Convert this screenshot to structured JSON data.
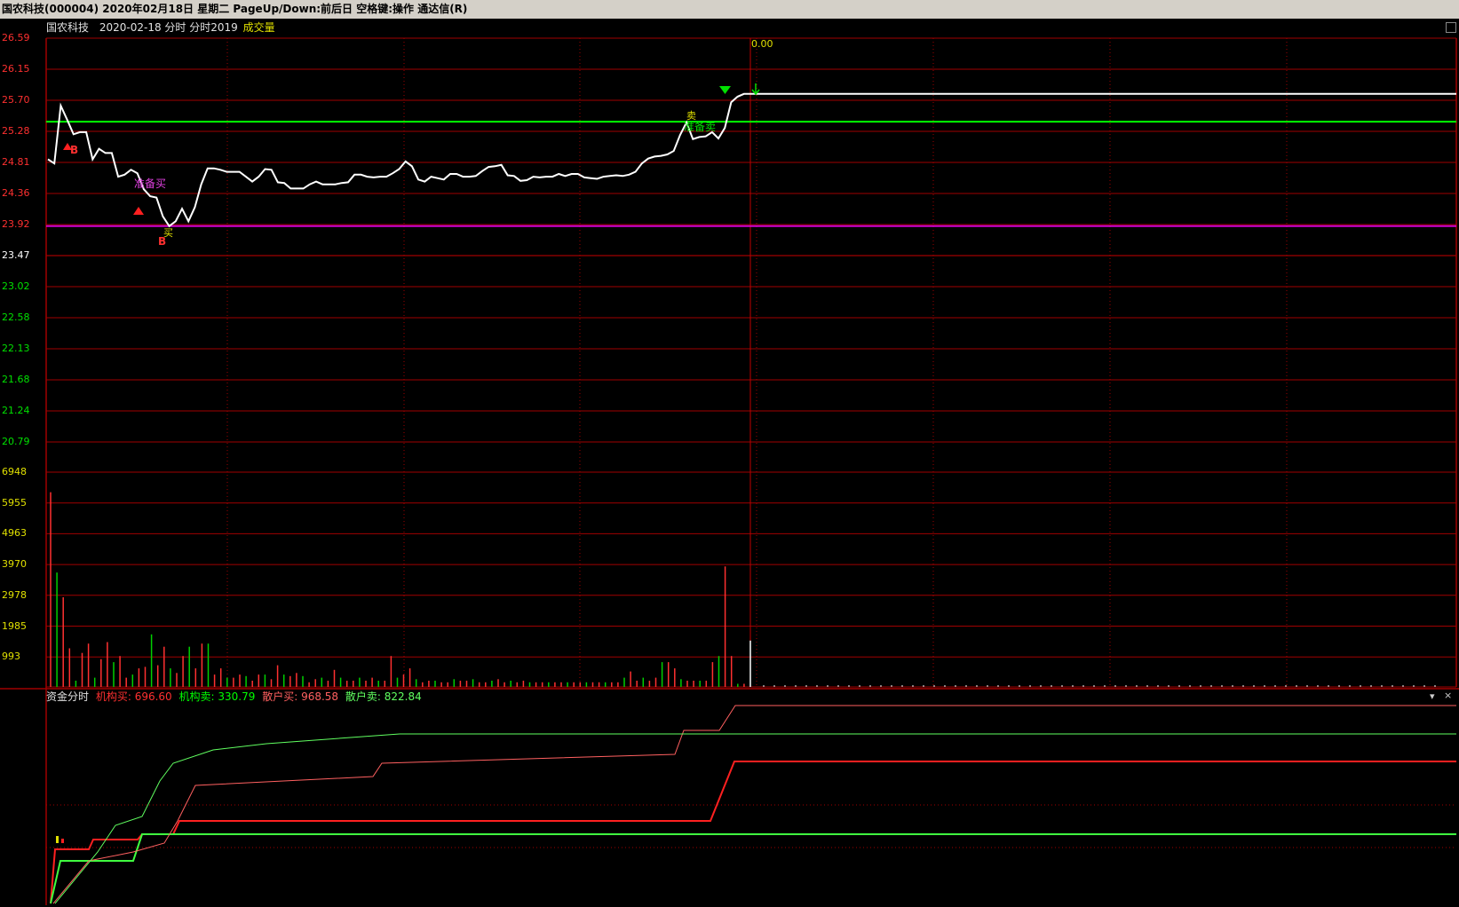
{
  "window": {
    "title": "国农科技(000004)  2020年02月18日  星期二  PageUp/Down:前后日  空格键:操作  通达信(R)"
  },
  "price_panel": {
    "stock_name": "国农科技",
    "date_mode": "2020-02-18  分时  分时2019",
    "volume_label": "成交量",
    "cursor_value": "0.00",
    "price_labels": [
      {
        "text": "26.59",
        "color": "#ff3030"
      },
      {
        "text": "26.15",
        "color": "#ff3030"
      },
      {
        "text": "25.70",
        "color": "#ff3030"
      },
      {
        "text": "25.28",
        "color": "#ff3030"
      },
      {
        "text": "24.81",
        "color": "#ff3030"
      },
      {
        "text": "24.36",
        "color": "#ff3030"
      },
      {
        "text": "23.92",
        "color": "#ff3030"
      },
      {
        "text": "23.47",
        "color": "#ffffff"
      },
      {
        "text": "23.02",
        "color": "#00e000"
      },
      {
        "text": "22.58",
        "color": "#00e000"
      },
      {
        "text": "22.13",
        "color": "#00e000"
      },
      {
        "text": "21.68",
        "color": "#00e000"
      },
      {
        "text": "21.24",
        "color": "#00e000"
      },
      {
        "text": "20.79",
        "color": "#00e000"
      }
    ],
    "signals": {
      "prepare_buy": "准备买",
      "buy": "买",
      "buy_mark": "B",
      "sell": "卖",
      "prepare_sell": "准备卖"
    }
  },
  "volume_panel": {
    "labels": [
      "6948",
      "5955",
      "4963",
      "3970",
      "2978",
      "1985",
      "993"
    ]
  },
  "fund_panel": {
    "title": "资金分时",
    "items": [
      {
        "label": "机构买: 696.60",
        "color": "#ff3030"
      },
      {
        "label": "机构卖: 330.79",
        "color": "#00ff00"
      },
      {
        "label": "散户买: 968.58",
        "color": "#ff6060"
      },
      {
        "label": "散户卖: 822.84",
        "color": "#60ff60"
      }
    ],
    "dropdown_icon": "chevron-down-icon",
    "close_icon": "close-icon"
  },
  "colors": {
    "grid": "#a00000",
    "price_line": "#ffffff",
    "upper_line": "#00ff00",
    "lower_line": "#d000d0",
    "label_yellow": "#e0e000"
  },
  "chart_data": {
    "type": "line",
    "series": [
      {
        "values": [
          24.85,
          24.79,
          25.62,
          25.42,
          25.21,
          25.24,
          25.24,
          24.85,
          25.0,
          24.94,
          24.94,
          24.6,
          24.63,
          24.7,
          24.65,
          24.42,
          24.32,
          24.3,
          24.03,
          23.89,
          23.96,
          24.14,
          23.96,
          24.16,
          24.49,
          24.72,
          24.72,
          24.7,
          24.67,
          24.67,
          24.67,
          24.6,
          24.53,
          24.6,
          24.71,
          24.7,
          24.52,
          24.51,
          24.43,
          24.43,
          24.43,
          24.49,
          24.53,
          24.49,
          24.49,
          24.49,
          24.51,
          24.52,
          24.63,
          24.63,
          24.6,
          24.59,
          24.6,
          24.6,
          24.65,
          24.71,
          24.82,
          24.75,
          24.56,
          24.53,
          24.6,
          24.58,
          24.56,
          24.64,
          24.64,
          24.6,
          24.6,
          24.61,
          24.68,
          24.74,
          24.75,
          24.77,
          24.62,
          24.61,
          24.54,
          24.55,
          24.6,
          24.59,
          24.6,
          24.6,
          24.64,
          24.61,
          24.64,
          24.64,
          24.59,
          24.58,
          24.57,
          24.6,
          24.61,
          24.62,
          24.61,
          24.63,
          24.67,
          24.79,
          24.86,
          24.89,
          24.9,
          24.92,
          24.97,
          25.2,
          25.38,
          25.14,
          25.17,
          25.18,
          25.24,
          25.15,
          25.3,
          25.67,
          25.75,
          25.79,
          25.79
        ]
      }
    ],
    "ylim": [
      20.79,
      26.59
    ],
    "upper_level": 25.39,
    "lower_level": 23.89,
    "volume": [
      6300,
      3700,
      2900,
      1250,
      200,
      1100,
      1400,
      300,
      900,
      1450,
      800,
      1000,
      300,
      400,
      600,
      650,
      1700,
      700,
      1300,
      600,
      450,
      1000,
      1300,
      600,
      1400,
      1400,
      400,
      600,
      300,
      300,
      400,
      350,
      200,
      400,
      400,
      250,
      700,
      400,
      350,
      450,
      350,
      150,
      250,
      300,
      200,
      550,
      300,
      200,
      200,
      300,
      200,
      300,
      200,
      200,
      1000,
      300,
      400,
      600,
      250,
      150,
      200,
      200,
      150,
      150,
      250,
      200,
      200,
      250,
      150,
      150,
      200,
      250,
      150,
      200,
      150,
      200,
      150,
      150,
      150,
      150,
      150,
      150,
      150,
      150,
      150,
      150,
      150,
      150,
      150,
      150,
      150,
      300,
      500,
      200,
      300,
      200,
      300,
      800,
      800,
      600,
      250,
      200,
      200,
      200,
      200,
      800,
      1000,
      3900,
      1000,
      100,
      100,
      1500
    ],
    "volume_ymax": 6948
  }
}
